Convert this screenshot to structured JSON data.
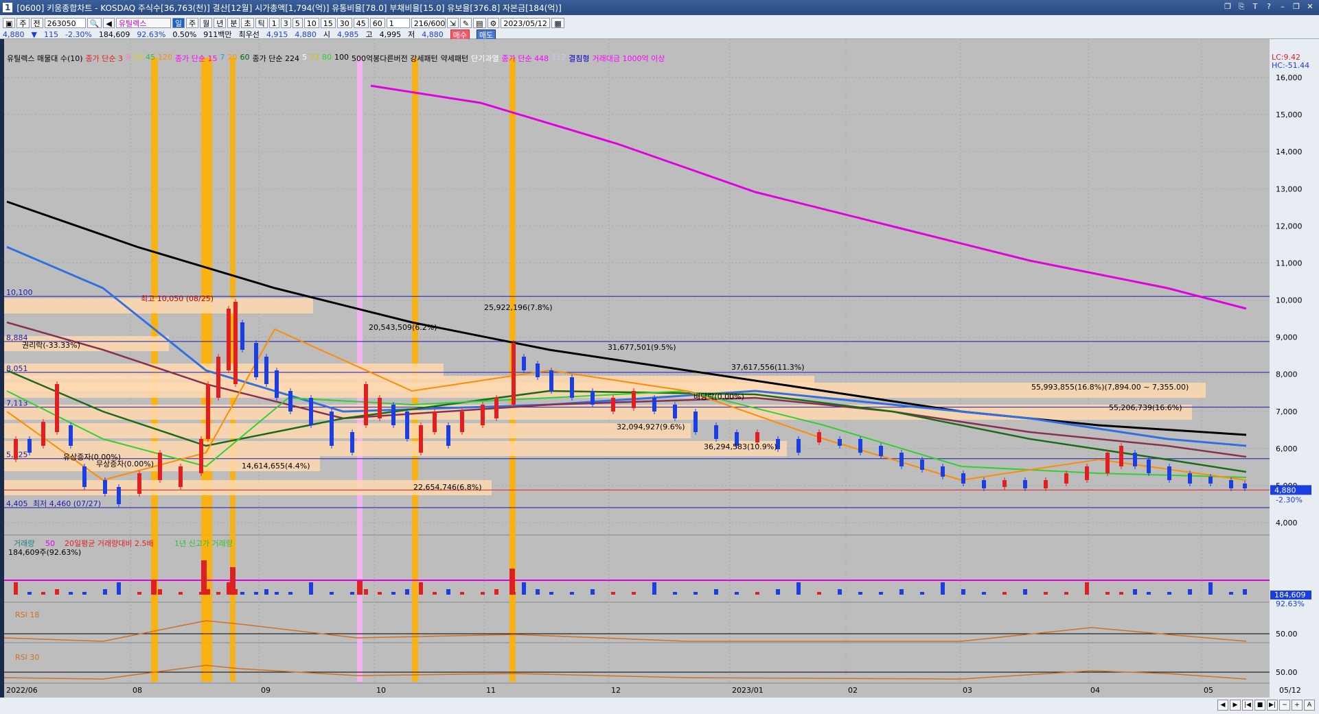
{
  "window": {
    "index": "1",
    "title": "[0600] 키움종합차트 - KOSDAQ 주식수[36,763(천)] 결산[12월] 시가총액[1,794(억)] 유통비율[78.0] 부채비율[15.0] 유보율[376.8] 자본금[184(억)]"
  },
  "toolbar": {
    "code": "263050",
    "name": "유틸렉스",
    "periods": [
      "일",
      "주",
      "월",
      "년",
      "분",
      "초",
      "틱"
    ],
    "minutes": [
      "1",
      "3",
      "5",
      "10",
      "15",
      "30",
      "45",
      "60"
    ],
    "interval": "1",
    "count": "216/600",
    "date": "2023/05/12",
    "mode_left": "주",
    "mode_right": "전",
    "buy": "매수",
    "sell": "매도"
  },
  "quote": {
    "price": "4,880",
    "arrow": "▼",
    "change": "115",
    "change_pct": "-2.30%",
    "volume": "184,609",
    "vol_ratio": "92.63%",
    "turnover": "0.50%",
    "amount": "911백만",
    "prefer_label": "최우선",
    "best_ask": "4,915",
    "best_bid": "4,880",
    "open_label": "시",
    "open": "4,985",
    "high_label": "고",
    "high": "4,995",
    "low_label": "저",
    "low": "4,880"
  },
  "legend": [
    {
      "text": "유틸렉스 매물대 수(10)",
      "color": "#000"
    },
    {
      "text": "종가 단순 3",
      "color": "#e02020"
    },
    {
      "text": "8",
      "color": "#ff7bd0"
    },
    {
      "text": "10",
      "color": "#d8d800"
    },
    {
      "text": "45",
      "color": "#30c030"
    },
    {
      "text": "120",
      "color": "#ff8c00"
    },
    {
      "text": "종가 단순 15",
      "color": "#ff00ff"
    },
    {
      "text": "7",
      "color": "#00aaff"
    },
    {
      "text": "20",
      "color": "#ff9900"
    },
    {
      "text": "60",
      "color": "#006000"
    },
    {
      "text": "종가 단순 224",
      "color": "#000"
    },
    {
      "text": "5",
      "color": "#fff"
    },
    {
      "text": "33",
      "color": "#c8c800"
    },
    {
      "text": "80",
      "color": "#30d030"
    },
    {
      "text": "100",
      "color": "#000"
    },
    {
      "text": "500억봉다른버전 강세패턴",
      "color": "#000"
    },
    {
      "text": "약세패턴",
      "color": "#000"
    },
    {
      "text": "단기과열",
      "color": "#fff"
    },
    {
      "text": "종가 단순 448",
      "color": "#ff00ff"
    },
    {
      "text": "112",
      "color": "#c8c8ff"
    },
    {
      "text": "결침형",
      "color": "#0000c0"
    },
    {
      "text": "거래대금 1000억 이상",
      "color": "#ff00ff"
    }
  ],
  "price_axis": [
    "16,000",
    "15,000",
    "14,000",
    "13,000",
    "12,000",
    "11,000",
    "10,000",
    "9,000",
    "8,000",
    "7,000",
    "6,000",
    "5,000",
    "4,000"
  ],
  "axis_info": {
    "lc": "LC:9.42",
    "hc": "HC:-51.44"
  },
  "levels": {
    "l1": "10,100",
    "l2": "8,884",
    "l3": "8,051",
    "l4": "7,113",
    "l5": "5,725",
    "l6": "4,405"
  },
  "annotations": {
    "high": "최고 10,050 (08/25)",
    "low": "최저 4,460 (07/27)",
    "rights": "권리락(-33.33%)",
    "cap1": "유상증자(0.00%)",
    "cap2": "무상증자(0.00%)",
    "vp1": "25,922,196(7.8%)",
    "vp2": "20,543,509(6.2%)",
    "vp3": "31,677,501(9.5%)",
    "vp4": "37,617,556(11.3%)",
    "vp5": "55,993,855(16.8%)(7,894.00 ~ 7,355.00)",
    "vp6": "55,206,739(16.6%)",
    "vp7": "32,094,927(9.6%)",
    "vp8": "36,294,583(10.9%)",
    "vp9": "14,614,655(4.4%)",
    "vp10": "22,654,746(6.8%)",
    "vp_mark": "배당락(0.00%)"
  },
  "last_price": {
    "value": "4,880",
    "pct": "-2.30%"
  },
  "volume_panel": {
    "legend1": "거래량",
    "legend1b": "50",
    "legend2": "20일평균 거래량대비 2.5배",
    "legend3": "1년 신고가 거래량",
    "value": "184,609주(92.63%)",
    "axis_value": "184,609",
    "axis_pct": "92.63%"
  },
  "rsi1": {
    "label": "RSI 18",
    "axis": "50.00"
  },
  "rsi2": {
    "label": "RSI 30",
    "axis": "50.00"
  },
  "x_axis": [
    "2022/06",
    "08",
    "09",
    "10",
    "11",
    "12",
    "2023/01",
    "02",
    "03",
    "04",
    "05",
    "05/12"
  ]
}
